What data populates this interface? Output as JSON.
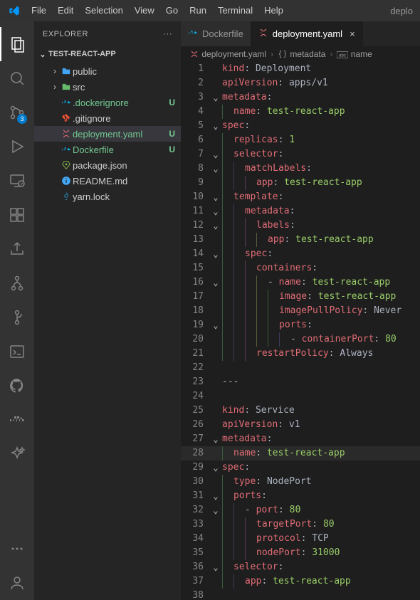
{
  "menu": {
    "items": [
      "File",
      "Edit",
      "Selection",
      "View",
      "Go",
      "Run",
      "Terminal",
      "Help"
    ],
    "titleRight": "deplo"
  },
  "activity": {
    "items": [
      {
        "name": "explorer-icon",
        "active": true
      },
      {
        "name": "search-icon"
      },
      {
        "name": "source-control-icon",
        "badge": "3"
      },
      {
        "name": "run-debug-icon"
      },
      {
        "name": "remote-explorer-icon"
      },
      {
        "name": "extensions-icon"
      },
      {
        "name": "share-icon"
      },
      {
        "name": "git-branch-icon"
      },
      {
        "name": "git-tree-icon"
      },
      {
        "name": "console-icon"
      },
      {
        "name": "github-icon"
      },
      {
        "name": "docker-icon"
      },
      {
        "name": "sparkle-icon"
      }
    ],
    "bottom": [
      {
        "name": "more-icon"
      },
      {
        "name": "accounts-icon"
      }
    ]
  },
  "sidebar": {
    "title": "EXPLORER",
    "more": "···",
    "section": "TEST-REACT-APP",
    "tree": [
      {
        "depth": 1,
        "twisty": "›",
        "icon": "folder-public",
        "iconColor": "#42a5f5",
        "label": "public"
      },
      {
        "depth": 1,
        "twisty": "›",
        "icon": "folder-src",
        "iconColor": "#66bb6a",
        "label": "src"
      },
      {
        "depth": 1,
        "icon": "docker",
        "iconColor": "#0db7ed",
        "label": ".dockerignore",
        "status": "U",
        "git": "new"
      },
      {
        "depth": 1,
        "icon": "git",
        "iconColor": "#f05133",
        "label": ".gitignore"
      },
      {
        "depth": 1,
        "icon": "yaml",
        "iconColor": "#e06c75",
        "label": "deployment.yaml",
        "status": "U",
        "git": "new",
        "selected": true
      },
      {
        "depth": 1,
        "icon": "docker",
        "iconColor": "#0db7ed",
        "label": "Dockerfile",
        "status": "U",
        "git": "new"
      },
      {
        "depth": 1,
        "icon": "npm",
        "iconColor": "#8bc34a",
        "label": "package.json"
      },
      {
        "depth": 1,
        "icon": "info",
        "iconColor": "#42a5f5",
        "label": "README.md"
      },
      {
        "depth": 1,
        "icon": "yarn",
        "iconColor": "#2c8ebb",
        "label": "yarn.lock"
      }
    ]
  },
  "tabs": [
    {
      "icon": "docker",
      "iconColor": "#0db7ed",
      "label": "Dockerfile",
      "active": false
    },
    {
      "icon": "yaml",
      "iconColor": "#e06c75",
      "label": "deployment.yaml",
      "active": true,
      "close": "×"
    }
  ],
  "breadcrumb": [
    {
      "icon": "yaml",
      "label": "deployment.yaml"
    },
    {
      "icon": "braces",
      "label": "metadata"
    },
    {
      "icon": "abc",
      "label": "name"
    }
  ],
  "code_lines": [
    {
      "n": 1,
      "fold": "",
      "indent": 0,
      "tokens": [
        [
          "key",
          "kind"
        ],
        [
          "punc",
          ": "
        ],
        [
          "plain",
          "Deployment"
        ]
      ]
    },
    {
      "n": 2,
      "fold": "",
      "indent": 0,
      "tokens": [
        [
          "key",
          "apiVersion"
        ],
        [
          "punc",
          ": "
        ],
        [
          "plain",
          "apps/v1"
        ]
      ]
    },
    {
      "n": 3,
      "fold": "v",
      "indent": 0,
      "tokens": [
        [
          "key",
          "metadata"
        ],
        [
          "punc",
          ":"
        ]
      ]
    },
    {
      "n": 4,
      "fold": "",
      "indent": 1,
      "tokens": [
        [
          "key",
          "name"
        ],
        [
          "punc",
          ": "
        ],
        [
          "str",
          "test-react-app"
        ]
      ]
    },
    {
      "n": 5,
      "fold": "v",
      "indent": 0,
      "tokens": [
        [
          "key",
          "spec"
        ],
        [
          "punc",
          ":"
        ]
      ]
    },
    {
      "n": 6,
      "fold": "",
      "indent": 1,
      "tokens": [
        [
          "key",
          "replicas"
        ],
        [
          "punc",
          ": "
        ],
        [
          "num",
          "1"
        ]
      ]
    },
    {
      "n": 7,
      "fold": "v",
      "indent": 1,
      "tokens": [
        [
          "key",
          "selector"
        ],
        [
          "punc",
          ":"
        ]
      ]
    },
    {
      "n": 8,
      "fold": "v",
      "indent": 2,
      "tokens": [
        [
          "key",
          "matchLabels"
        ],
        [
          "punc",
          ":"
        ]
      ]
    },
    {
      "n": 9,
      "fold": "",
      "indent": 3,
      "tokens": [
        [
          "key",
          "app"
        ],
        [
          "punc",
          ": "
        ],
        [
          "str",
          "test-react-app"
        ]
      ]
    },
    {
      "n": 10,
      "fold": "v",
      "indent": 1,
      "tokens": [
        [
          "key",
          "template"
        ],
        [
          "punc",
          ":"
        ]
      ]
    },
    {
      "n": 11,
      "fold": "v",
      "indent": 2,
      "tokens": [
        [
          "key",
          "metadata"
        ],
        [
          "punc",
          ":"
        ]
      ]
    },
    {
      "n": 12,
      "fold": "v",
      "indent": 3,
      "tokens": [
        [
          "key",
          "labels"
        ],
        [
          "punc",
          ":"
        ]
      ]
    },
    {
      "n": 13,
      "fold": "",
      "indent": 4,
      "tokens": [
        [
          "key",
          "app"
        ],
        [
          "punc",
          ": "
        ],
        [
          "str",
          "test-react-app"
        ]
      ]
    },
    {
      "n": 14,
      "fold": "v",
      "indent": 2,
      "tokens": [
        [
          "key",
          "spec"
        ],
        [
          "punc",
          ":"
        ]
      ]
    },
    {
      "n": 15,
      "fold": "",
      "indent": 3,
      "tokens": [
        [
          "key",
          "containers"
        ],
        [
          "punc",
          ":"
        ]
      ]
    },
    {
      "n": 16,
      "fold": "v",
      "indent": 4,
      "tokens": [
        [
          "dash",
          "- "
        ],
        [
          "key",
          "name"
        ],
        [
          "punc",
          ": "
        ],
        [
          "str",
          "test-react-app"
        ]
      ]
    },
    {
      "n": 17,
      "fold": "",
      "indent": 5,
      "tokens": [
        [
          "key",
          "image"
        ],
        [
          "punc",
          ": "
        ],
        [
          "str",
          "test-react-app"
        ]
      ]
    },
    {
      "n": 18,
      "fold": "",
      "indent": 5,
      "tokens": [
        [
          "key",
          "imagePullPolicy"
        ],
        [
          "punc",
          ": "
        ],
        [
          "plain",
          "Never"
        ]
      ]
    },
    {
      "n": 19,
      "fold": "v",
      "indent": 5,
      "tokens": [
        [
          "key",
          "ports"
        ],
        [
          "punc",
          ":"
        ]
      ]
    },
    {
      "n": 20,
      "fold": "",
      "indent": 6,
      "tokens": [
        [
          "dash",
          "- "
        ],
        [
          "key",
          "containerPort"
        ],
        [
          "punc",
          ": "
        ],
        [
          "num",
          "80"
        ]
      ]
    },
    {
      "n": 21,
      "fold": "",
      "indent": 3,
      "tokens": [
        [
          "key",
          "restartPolicy"
        ],
        [
          "punc",
          ": "
        ],
        [
          "plain",
          "Always"
        ]
      ]
    },
    {
      "n": 22,
      "fold": "",
      "indent": 0,
      "tokens": []
    },
    {
      "n": 23,
      "fold": "",
      "indent": 0,
      "tokens": [
        [
          "plain",
          "---"
        ]
      ]
    },
    {
      "n": 24,
      "fold": "",
      "indent": 0,
      "tokens": []
    },
    {
      "n": 25,
      "fold": "",
      "indent": 0,
      "tokens": [
        [
          "key",
          "kind"
        ],
        [
          "punc",
          ": "
        ],
        [
          "plain",
          "Service"
        ]
      ]
    },
    {
      "n": 26,
      "fold": "",
      "indent": 0,
      "tokens": [
        [
          "key",
          "apiVersion"
        ],
        [
          "punc",
          ": "
        ],
        [
          "plain",
          "v1"
        ]
      ]
    },
    {
      "n": 27,
      "fold": "v",
      "indent": 0,
      "tokens": [
        [
          "key",
          "metadata"
        ],
        [
          "punc",
          ":"
        ]
      ]
    },
    {
      "n": 28,
      "fold": "",
      "indent": 1,
      "current": true,
      "tokens": [
        [
          "key",
          "name"
        ],
        [
          "punc",
          ": "
        ],
        [
          "str",
          "test-react-app"
        ]
      ]
    },
    {
      "n": 29,
      "fold": "v",
      "indent": 0,
      "tokens": [
        [
          "key",
          "spec"
        ],
        [
          "punc",
          ":"
        ]
      ]
    },
    {
      "n": 30,
      "fold": "",
      "indent": 1,
      "tokens": [
        [
          "key",
          "type"
        ],
        [
          "punc",
          ": "
        ],
        [
          "plain",
          "NodePort"
        ]
      ]
    },
    {
      "n": 31,
      "fold": "v",
      "indent": 1,
      "tokens": [
        [
          "key",
          "ports"
        ],
        [
          "punc",
          ":"
        ]
      ]
    },
    {
      "n": 32,
      "fold": "v",
      "indent": 2,
      "tokens": [
        [
          "dash",
          "- "
        ],
        [
          "key",
          "port"
        ],
        [
          "punc",
          ": "
        ],
        [
          "num",
          "80"
        ]
      ]
    },
    {
      "n": 33,
      "fold": "",
      "indent": 3,
      "tokens": [
        [
          "key",
          "targetPort"
        ],
        [
          "punc",
          ": "
        ],
        [
          "num",
          "80"
        ]
      ]
    },
    {
      "n": 34,
      "fold": "",
      "indent": 3,
      "tokens": [
        [
          "key",
          "protocol"
        ],
        [
          "punc",
          ": "
        ],
        [
          "plain",
          "TCP"
        ]
      ]
    },
    {
      "n": 35,
      "fold": "",
      "indent": 3,
      "tokens": [
        [
          "key",
          "nodePort"
        ],
        [
          "punc",
          ": "
        ],
        [
          "num",
          "31000"
        ]
      ]
    },
    {
      "n": 36,
      "fold": "v",
      "indent": 1,
      "tokens": [
        [
          "key",
          "selector"
        ],
        [
          "punc",
          ":"
        ]
      ]
    },
    {
      "n": 37,
      "fold": "",
      "indent": 2,
      "tokens": [
        [
          "key",
          "app"
        ],
        [
          "punc",
          ": "
        ],
        [
          "str",
          "test-react-app"
        ]
      ]
    },
    {
      "n": 38,
      "fold": "",
      "indent": 0,
      "tokens": []
    }
  ]
}
